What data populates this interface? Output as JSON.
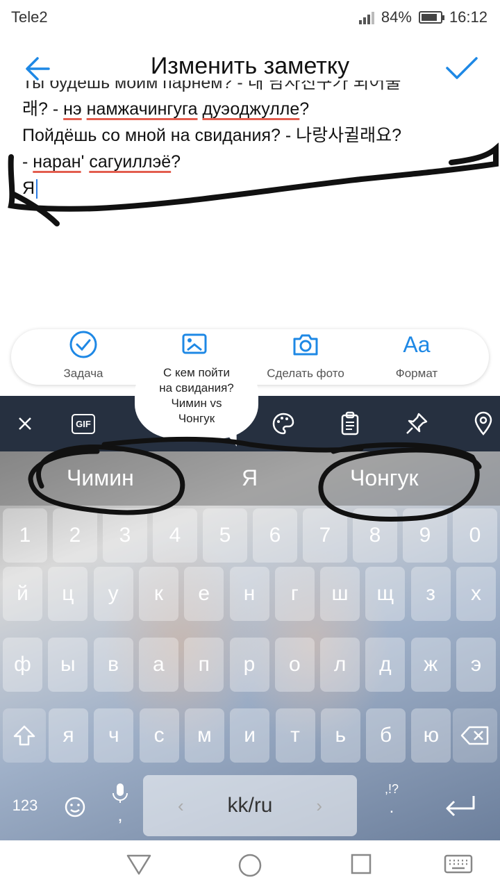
{
  "status": {
    "carrier": "Tele2",
    "battery": "84%",
    "battery_level": 84,
    "time": "16:12"
  },
  "header": {
    "title": "Изменить заметку"
  },
  "note": {
    "line0": "Ты будешь моим парнем? - 내 남자친구가 되어줄",
    "line1_a": "래? - ",
    "line1_b": "нэ",
    "line1_c": " ",
    "line1_d": "намжачингуга",
    "line1_e": " ",
    "line1_f": "дуэоджулле",
    "line1_g": "?",
    "line2": "Пойдёшь со мной на свидания? - 나랑사귈래요?",
    "line3_a": "- ",
    "line3_b": "наран",
    "line3_c": "' ",
    "line3_d": "сагуиллэё",
    "line3_e": "?",
    "line4": "Я"
  },
  "toolbar": [
    {
      "label": "Задача",
      "icon": "check-circle-icon"
    },
    {
      "label": "",
      "icon": "image-icon"
    },
    {
      "label": "Сделать фото",
      "icon": "camera-icon"
    },
    {
      "label": "Формат",
      "icon": "format-icon",
      "glyph": "Aa"
    }
  ],
  "bubble": {
    "text1": "С кем пойти",
    "text2": "на свидания?",
    "text3": "Чимин vs",
    "text4": "Чонгук"
  },
  "keyboard": {
    "top_icons": [
      "close-icon",
      "gif-icon",
      "palette-icon",
      "clipboard-icon",
      "pin-icon",
      "location-icon"
    ],
    "gif_label": "GIF",
    "suggestions": [
      "Чимин",
      "Я",
      "Чонгук"
    ],
    "row_numbers": [
      "1",
      "2",
      "3",
      "4",
      "5",
      "6",
      "7",
      "8",
      "9",
      "0"
    ],
    "row1": [
      "й",
      "ц",
      "у",
      "к",
      "е",
      "н",
      "г",
      "ш",
      "щ",
      "з",
      "х"
    ],
    "row2": [
      "ф",
      "ы",
      "в",
      "а",
      "п",
      "р",
      "о",
      "л",
      "д",
      "ж",
      "э"
    ],
    "row3": [
      "я",
      "ч",
      "с",
      "м",
      "и",
      "т",
      "ь",
      "б",
      "ю"
    ],
    "symbols_label": "123",
    "comma": ",",
    "space_label": "kk/ru",
    "punct_top": ",!?",
    "punct_bottom": "."
  },
  "colors": {
    "accent": "#1e88e5",
    "keyboard_top": "#263040"
  }
}
